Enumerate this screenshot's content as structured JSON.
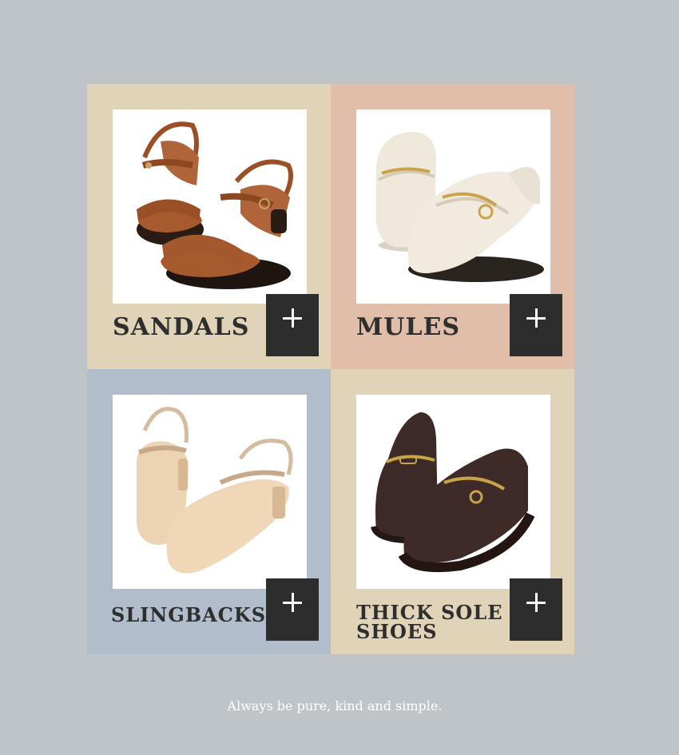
{
  "categories": [
    {
      "name": "SANDALS",
      "bg": "#e0d3b7",
      "image": "brown-strap-sandals"
    },
    {
      "name": "MULES",
      "bg": "#e1bea9",
      "image": "cream-horsebit-mules"
    },
    {
      "name": "SLINGBACKS",
      "bg": "#b1bdcb",
      "image": "nude-slingback-heels"
    },
    {
      "name": "THICK SOLE SHOES",
      "line1": "THICK SOLE",
      "line2": "SHOES",
      "bg": "#e0d3b7",
      "image": "dark-brown-chunky-loafers"
    }
  ],
  "tagline": "Always be pure, kind and simple.",
  "colors": {
    "page_bg": "#bfc4c8",
    "button_bg": "#2d2d2d",
    "label_text": "#2e2e2e"
  }
}
